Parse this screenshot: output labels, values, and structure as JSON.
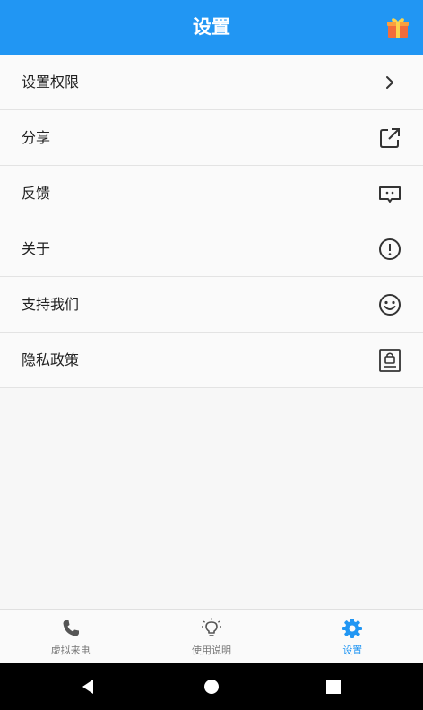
{
  "header": {
    "title": "设置"
  },
  "settings": {
    "items": [
      {
        "label": "设置权限",
        "icon": "chevron-right-icon"
      },
      {
        "label": "分享",
        "icon": "share-external-icon"
      },
      {
        "label": "反馈",
        "icon": "feedback-message-icon"
      },
      {
        "label": "关于",
        "icon": "info-exclamation-icon"
      },
      {
        "label": "支持我们",
        "icon": "smiley-face-icon"
      },
      {
        "label": "隐私政策",
        "icon": "privacy-lock-document-icon"
      }
    ]
  },
  "tabbar": {
    "tabs": [
      {
        "label": "虚拟来电",
        "icon": "phone-icon",
        "active": false
      },
      {
        "label": "使用说明",
        "icon": "lightbulb-icon",
        "active": false
      },
      {
        "label": "设置",
        "icon": "gear-icon",
        "active": true
      }
    ]
  },
  "colors": {
    "accent": "#2196f3",
    "text": "#222222",
    "tab_inactive": "#777777"
  }
}
